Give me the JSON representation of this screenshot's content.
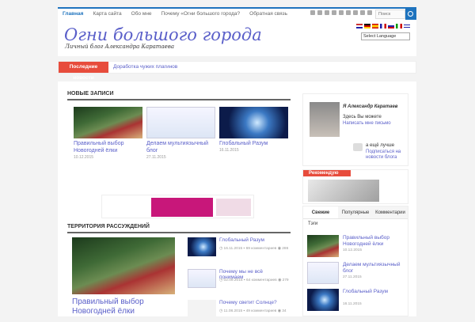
{
  "nav": {
    "items": [
      "Главная",
      "Карта сайта",
      "Обо мне",
      "Почему «Огни большого города?",
      "Обратная связь"
    ],
    "search_placeholder": "Поиск"
  },
  "header": {
    "title": "Огни большого города",
    "subtitle": "Личный блог Александра Каратаева",
    "language_select": "Select Language"
  },
  "ticker": {
    "label": "Последние новости",
    "text": "Доработка чужих плагинов"
  },
  "new_posts": {
    "heading": "Новые записи",
    "cards": [
      {
        "title": "Правильный выбор Новогодней ёлки",
        "date": "10.12.2015"
      },
      {
        "title": "Делаем мультиязычный блог",
        "date": "27.11.2015"
      },
      {
        "title": "Глобальный Разум",
        "date": "16.11.2015"
      }
    ]
  },
  "territory": {
    "heading": "Территория рассуждений",
    "main_title": "Правильный выбор Новогодней ёлки",
    "items": [
      {
        "title": "Глобальный Разум",
        "date": "16.11.2015",
        "comments": "69 комментариев",
        "views": "286"
      },
      {
        "title": "Почему мы не всё понимаем",
        "date": "02.09.2015",
        "comments": "64 комментариев",
        "views": "279"
      },
      {
        "title": "Почему светит Солнце?",
        "date": "11.08.2015",
        "comments": "49 комментариев",
        "views": "34"
      }
    ]
  },
  "sidebar": {
    "author_heading": "Я Александр Каратаев",
    "author_line1": "Здесь Вы можете",
    "author_link1": "Написать мне письмо",
    "author_line2": "а ещё лучше",
    "author_link2": "Подписаться на новости блога",
    "recommend_heading": "Рекомендую",
    "tabs": [
      "Свежие",
      "Популярные",
      "Комментарии"
    ],
    "tags_label": "Тэги",
    "fresh": [
      {
        "title": "Правильный выбор Новогодней ёлки",
        "date": "10.12.2015"
      },
      {
        "title": "Делаем мультиязычный блог",
        "date": "27.11.2015"
      },
      {
        "title": "Глобальный Разум",
        "date": "16.11.2015"
      }
    ]
  },
  "colors": {
    "accent": "#1e73be",
    "link": "#5a5fc9",
    "ticker_red": "#e74c3c"
  }
}
